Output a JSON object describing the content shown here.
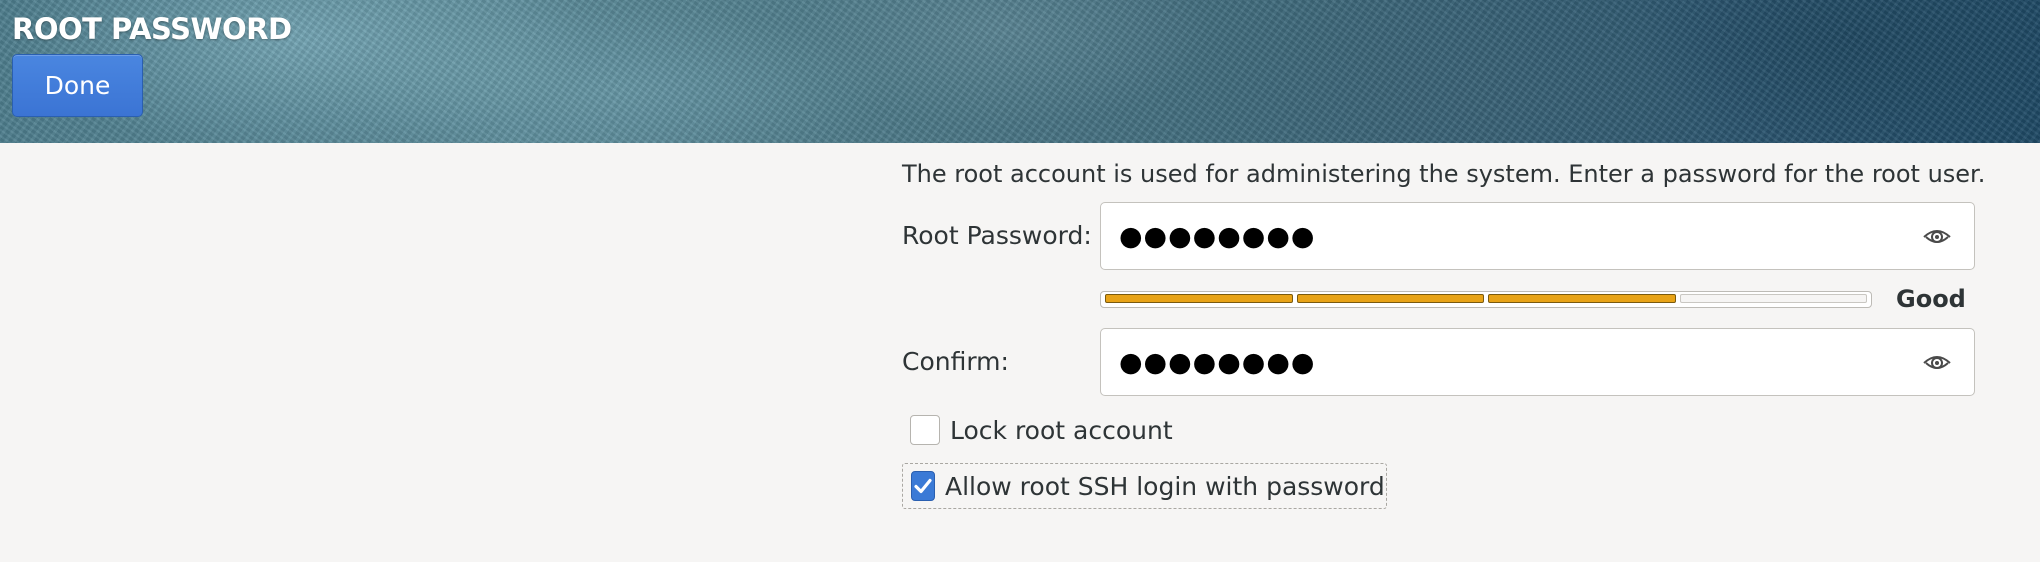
{
  "header": {
    "title": "ROOT PASSWORD",
    "done_label": "Done"
  },
  "description": "The root account is used for administering the system.  Enter a password for the root user.",
  "fields": {
    "root_password": {
      "label": "Root Password:",
      "masked_value": "●●●●●●●●",
      "icon": "eye-icon"
    },
    "confirm": {
      "label": "Confirm:",
      "masked_value": "●●●●●●●●",
      "icon": "eye-icon"
    }
  },
  "strength": {
    "label": "Good",
    "segments_total": 4,
    "segments_filled": 3,
    "color": "#e8a317"
  },
  "options": {
    "lock_root": {
      "label": "Lock root account",
      "checked": false
    },
    "allow_ssh": {
      "label": "Allow root SSH login with password",
      "checked": true
    }
  },
  "colors": {
    "accent": "#3b7ad6",
    "background": "#f6f5f4"
  }
}
